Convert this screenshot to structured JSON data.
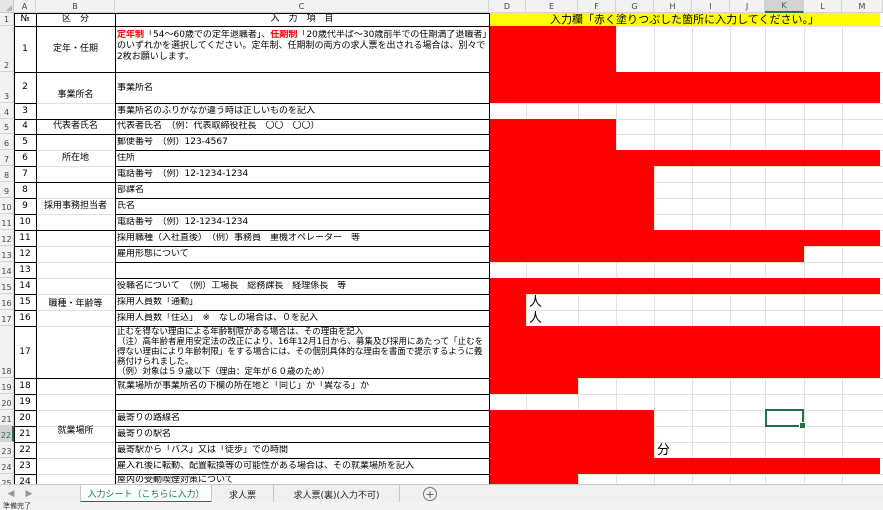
{
  "columns": [
    "A",
    "B",
    "C",
    "D",
    "E",
    "F",
    "G",
    "H",
    "I",
    "J",
    "K",
    "L",
    "M"
  ],
  "selected_column": "K",
  "rows": [
    "1",
    "2",
    "3",
    "4",
    "5",
    "6",
    "7",
    "8",
    "9",
    "10",
    "11",
    "12",
    "13",
    "14",
    "15",
    "16",
    "17",
    "18",
    "19",
    "20",
    "21",
    "22",
    "23",
    "24",
    "25"
  ],
  "selected_row": "22",
  "header": {
    "no": "№",
    "kubun": "区　分",
    "item": "入　力　項　目",
    "input_banner": "入力欄「赤く塗りつぶした箇所に入力してください。」"
  },
  "nos": [
    "1",
    "2",
    "3",
    "4",
    "5",
    "6",
    "7",
    "8",
    "9",
    "10",
    "11",
    "12",
    "13",
    "14",
    "15",
    "16",
    "17",
    "18",
    "19",
    "20",
    "21",
    "22",
    "23",
    "24"
  ],
  "categories": {
    "teinen": "定年・任期",
    "jigyosho": "事業所名",
    "daihyo": "代表者氏名",
    "shozaichi": "所在地",
    "tanto": "採用事務担当者",
    "shokushu": "職種・年齢等",
    "shugyo": "就業場所"
  },
  "items": {
    "teinen_part1": "定年制",
    "teinen_part2": "「54～60歳での定年退職者」、",
    "teinen_part3": "任期制",
    "teinen_part4": "「20歳代半ば～30歳前半での任期満了退職者」のいずれかを選択してください。定年制、任期制の両方の求人票を出される場合は、別々で2枚お願いします。",
    "jigyosho_name": "事業所名",
    "furigana": "事業所名のふりがなが違う時は正しいものを記入",
    "daihyo_name": "代表者氏名　（例：代表取締役社長　〇〇　〇〇）",
    "yubin": "郵便番号　（例）123-4567",
    "jusho": "住所",
    "denwa": "電話番号　（例）12-1234-1234",
    "busho": "部課名",
    "shimei": "氏名",
    "denwa2": "電話番号　（例）12-1234-1234",
    "shokushu": "採用職種（入社直後）　（例）事務員　重機オペレーター　等",
    "koyo": "雇用形態について",
    "yakushoku": "役職名について　（例）工場長　総務課長　経理係長　等",
    "ninzu_tsukin": "採用人員数「通勤」",
    "ninzu_sumikomi": "採用人員数「住込」　※　なしの場合は、０を記入",
    "nenrei": "止むを得ない理由による年齢制限がある場合は、その理由を記入\n（注）高年齢者雇用安定法の改正により、16年12月1日から、募集及び採用にあたって「止むを得ない理由により年齢制限」をする場合には、その個別具体的な理由を書面で提示するように義務付けられました。\n（例）対象は５９歳以下（理由：定年が６０歳のため）",
    "shugyo_basho": "就業場所が事業所名の下欄の所在地と「同じ」か「異なる」か",
    "eki_line": "最寄りの路線名",
    "eki_name": "最寄りの駅名",
    "jikan": "最寄駅から「バス」又は「徒歩」での時間",
    "tenkin": "雇入れ後に転勤、配置転換等の可能性がある場合は、その就業場所を記入",
    "last_row": "屋内の受動喫煙対策について"
  },
  "units": {
    "nin1": "人",
    "nin2": "人",
    "fun": "分"
  },
  "tabs": [
    {
      "label": "入力シート（こちらに入力）",
      "active": true
    },
    {
      "label": "求人票",
      "active": false
    },
    {
      "label": "求人票(裏)(入力不可)",
      "active": false
    }
  ],
  "status": "準備完了",
  "colors": {
    "input_red": "#ff0000",
    "banner_yellow": "#ffff00",
    "excel_green": "#217346"
  }
}
